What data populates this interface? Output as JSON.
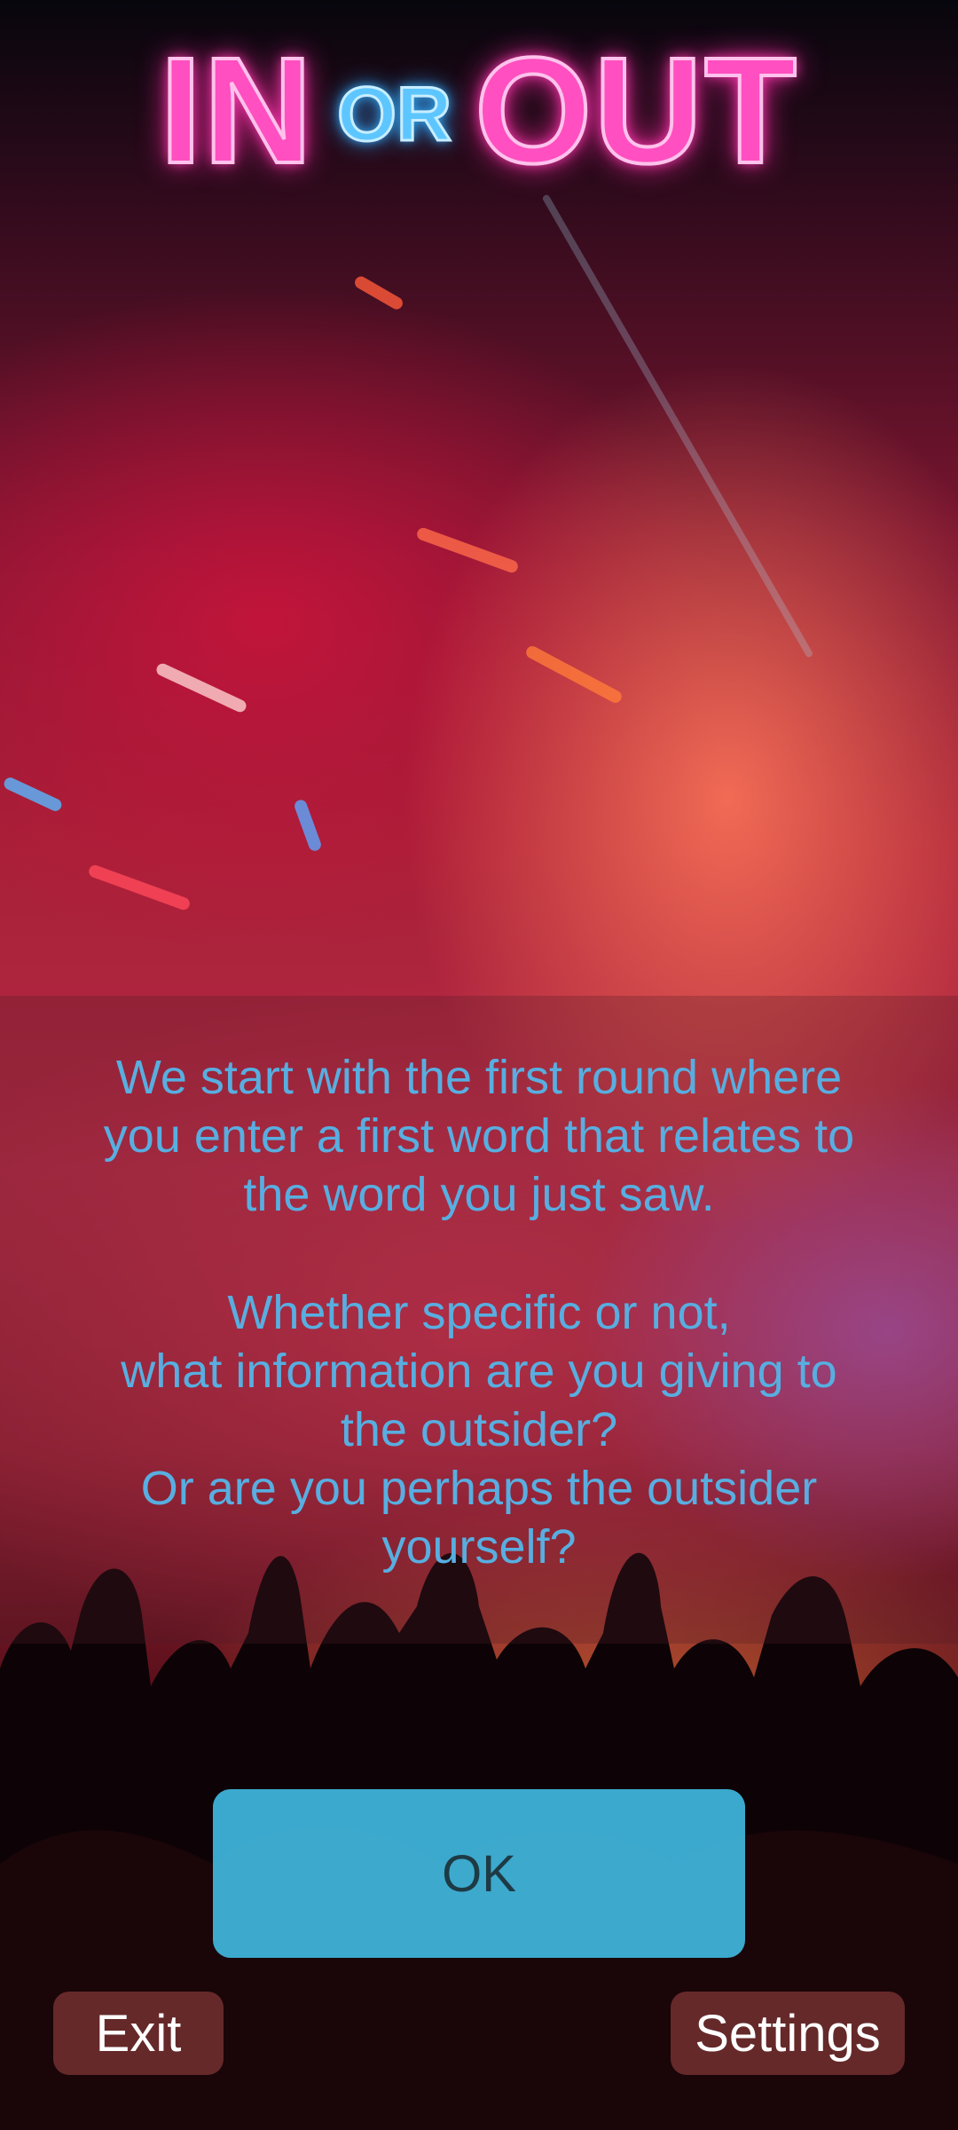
{
  "title": {
    "in": "IN",
    "or": "OR",
    "out": "OUT"
  },
  "message": {
    "paragraph1": [
      "We start with the first round where",
      "you enter a first word that relates to",
      "the word you just saw."
    ],
    "paragraph2": [
      "Whether specific or not,",
      "what information are you giving to",
      "the outsider?",
      "Or are you perhaps the outsider",
      "yourself?"
    ]
  },
  "buttons": {
    "ok": "OK",
    "exit": "Exit",
    "settings": "Settings"
  },
  "colors": {
    "title_pink": "#ff4fc0",
    "title_blue": "#5ec6ff",
    "message_text": "#58aee0",
    "ok_button": "#3fb7de",
    "secondary_button": "#823737"
  }
}
